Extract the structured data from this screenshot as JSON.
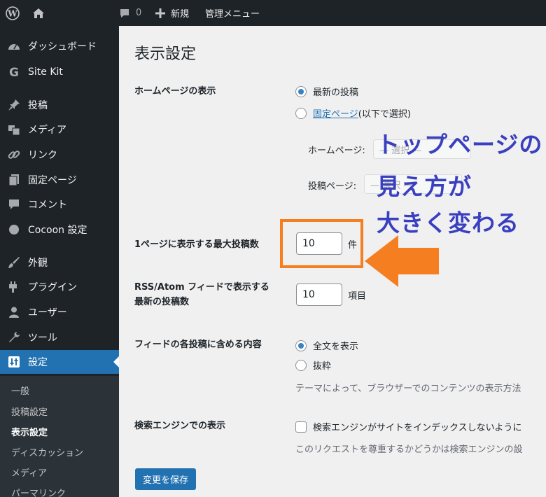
{
  "adminbar": {
    "comments_count": "0",
    "new_label": "新規",
    "admin_menu_label": "管理メニュー"
  },
  "sidebar": {
    "items": [
      {
        "label": "ダッシュボード",
        "icon": "dashboard-icon"
      },
      {
        "label": "Site Kit",
        "icon": "google-g-icon"
      },
      {
        "label": "投稿",
        "icon": "pushpin-icon"
      },
      {
        "label": "メディア",
        "icon": "media-icon"
      },
      {
        "label": "リンク",
        "icon": "link-icon"
      },
      {
        "label": "固定ページ",
        "icon": "page-icon"
      },
      {
        "label": "コメント",
        "icon": "comment-icon"
      },
      {
        "label": "Cocoon 設定",
        "icon": "circle-icon"
      },
      {
        "label": "外観",
        "icon": "brush-icon"
      },
      {
        "label": "プラグイン",
        "icon": "plugin-icon"
      },
      {
        "label": "ユーザー",
        "icon": "user-icon"
      },
      {
        "label": "ツール",
        "icon": "wrench-icon"
      },
      {
        "label": "設定",
        "icon": "settings-icon",
        "active": true
      }
    ],
    "submenu": [
      {
        "label": "一般"
      },
      {
        "label": "投稿設定"
      },
      {
        "label": "表示設定",
        "current": true
      },
      {
        "label": "ディスカッション"
      },
      {
        "label": "メディア"
      },
      {
        "label": "パーマリンク"
      }
    ]
  },
  "main": {
    "title": "表示設定",
    "homepage": {
      "label": "ホームページの表示",
      "option_latest": "最新の投稿",
      "option_static_link": "固定ページ",
      "option_static_suffix": " (以下で選択)",
      "homepage_select_label": "ホームページ:",
      "homepage_select_value": "— 選択 —",
      "posts_select_label": "投稿ページ:",
      "posts_select_value": "— 選択 —"
    },
    "posts_per_page": {
      "label": "1ページに表示する最大投稿数",
      "value": "10",
      "unit": "件"
    },
    "rss_posts": {
      "label_line1": "RSS/Atom フィードで表示する",
      "label_line2": "最新の投稿数",
      "value": "10",
      "unit": "項目"
    },
    "feed_content": {
      "label": "フィードの各投稿に含める内容",
      "option_full": "全文を表示",
      "option_excerpt": "抜粋",
      "description": "テーマによって、ブラウザーでのコンテンツの表示方法"
    },
    "search_engine": {
      "label": "検索エンジンでの表示",
      "checkbox_label": "検索エンジンがサイトをインデックスしないように",
      "description": "このリクエストを尊重するかどうかは検索エンジンの設"
    },
    "save_label": "変更を保存"
  },
  "annotation": {
    "line1": "トップページの",
    "line2": "見え方が",
    "line3": "大きく変わる",
    "color": "#3a3fbf",
    "highlight_color": "#f47e20"
  }
}
